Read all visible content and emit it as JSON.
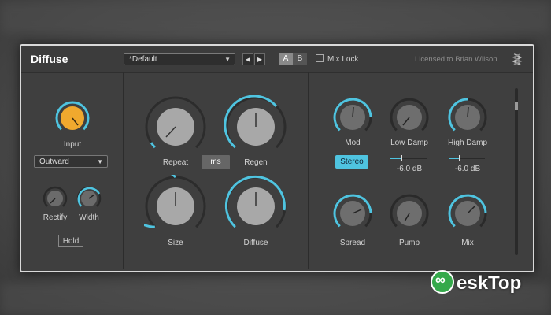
{
  "header": {
    "title": "Diffuse",
    "preset": "*Default",
    "nav_prev": "◀",
    "nav_next": "▶",
    "ab_a": "A",
    "ab_b": "B",
    "mix_lock": "Mix Lock",
    "license": "Licensed to Brian Wilson"
  },
  "left": {
    "input_label": "Input",
    "mode_select": "Outward",
    "rectify_label": "Rectify",
    "width_label": "Width",
    "hold_label": "Hold"
  },
  "middle": {
    "repeat_label": "Repeat",
    "ms_label": "ms",
    "regen_label": "Regen",
    "size_label": "Size",
    "diffuse_label": "Diffuse"
  },
  "right": {
    "mod_label": "Mod",
    "low_damp_label": "Low Damp",
    "high_damp_label": "High Damp",
    "stereo_label": "Stereo",
    "low_damp_value": "-6.0 dB",
    "high_damp_value": "-6.0 dB",
    "spread_label": "Spread",
    "pump_label": "Pump",
    "mix_label": "Mix"
  },
  "watermark": {
    "text": "eskTop"
  },
  "colors": {
    "accent": "#4fc4e0",
    "input_knob": "#f0a92e",
    "panel": "#3f3f3f"
  }
}
